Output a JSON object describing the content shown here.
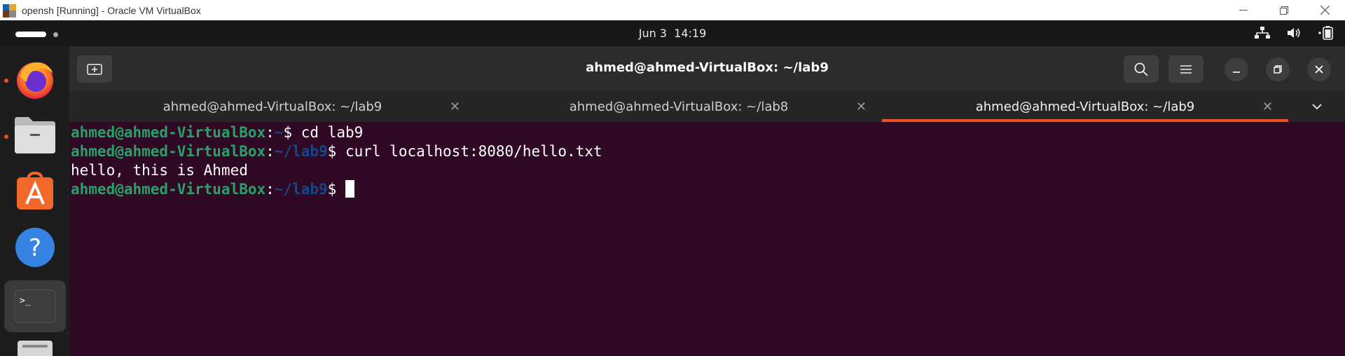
{
  "host_window": {
    "title": "opensh [Running] - Oracle VM VirtualBox",
    "controls": [
      "minimize",
      "restore",
      "close"
    ]
  },
  "topbar": {
    "date": "Jun 3",
    "time": "14:19",
    "tray_icons": [
      "network-icon",
      "volume-icon",
      "battery-icon"
    ]
  },
  "dock": {
    "apps": [
      {
        "name": "Firefox",
        "icon": "firefox-icon",
        "running": true
      },
      {
        "name": "Files",
        "icon": "files-icon",
        "running": true
      },
      {
        "name": "Ubuntu Software",
        "icon": "software-icon",
        "running": false
      },
      {
        "name": "Help",
        "icon": "help-icon",
        "running": false
      },
      {
        "name": "Terminal",
        "icon": "terminal-icon",
        "running": true,
        "active": true
      },
      {
        "name": "Disk",
        "icon": "disk-icon",
        "running": false
      }
    ]
  },
  "terminal": {
    "title": "ahmed@ahmed-VirtualBox: ~/lab9",
    "tabs": [
      {
        "label": "ahmed@ahmed-VirtualBox: ~/lab9",
        "active": false
      },
      {
        "label": "ahmed@ahmed-VirtualBox: ~/lab8",
        "active": false
      },
      {
        "label": "ahmed@ahmed-VirtualBox: ~/lab9",
        "active": true
      }
    ],
    "tab_close": "✕",
    "lines": [
      {
        "user": "ahmed@ahmed-VirtualBox",
        "sep": ":",
        "path": "~",
        "prompt": "$ ",
        "cmd": "cd lab9"
      },
      {
        "user": "ahmed@ahmed-VirtualBox",
        "sep": ":",
        "path": "~/lab9",
        "prompt": "$ ",
        "cmd": "curl localhost:8080/hello.txt"
      },
      {
        "output": "hello, this is Ahmed"
      },
      {
        "user": "ahmed@ahmed-VirtualBox",
        "sep": ":",
        "path": "~/lab9",
        "prompt": "$ ",
        "cmd": ""
      }
    ]
  },
  "colors": {
    "terminal_bg": "#300a24",
    "prompt_user": "#26a269",
    "prompt_path": "#12488b",
    "accent": "#e95420"
  }
}
